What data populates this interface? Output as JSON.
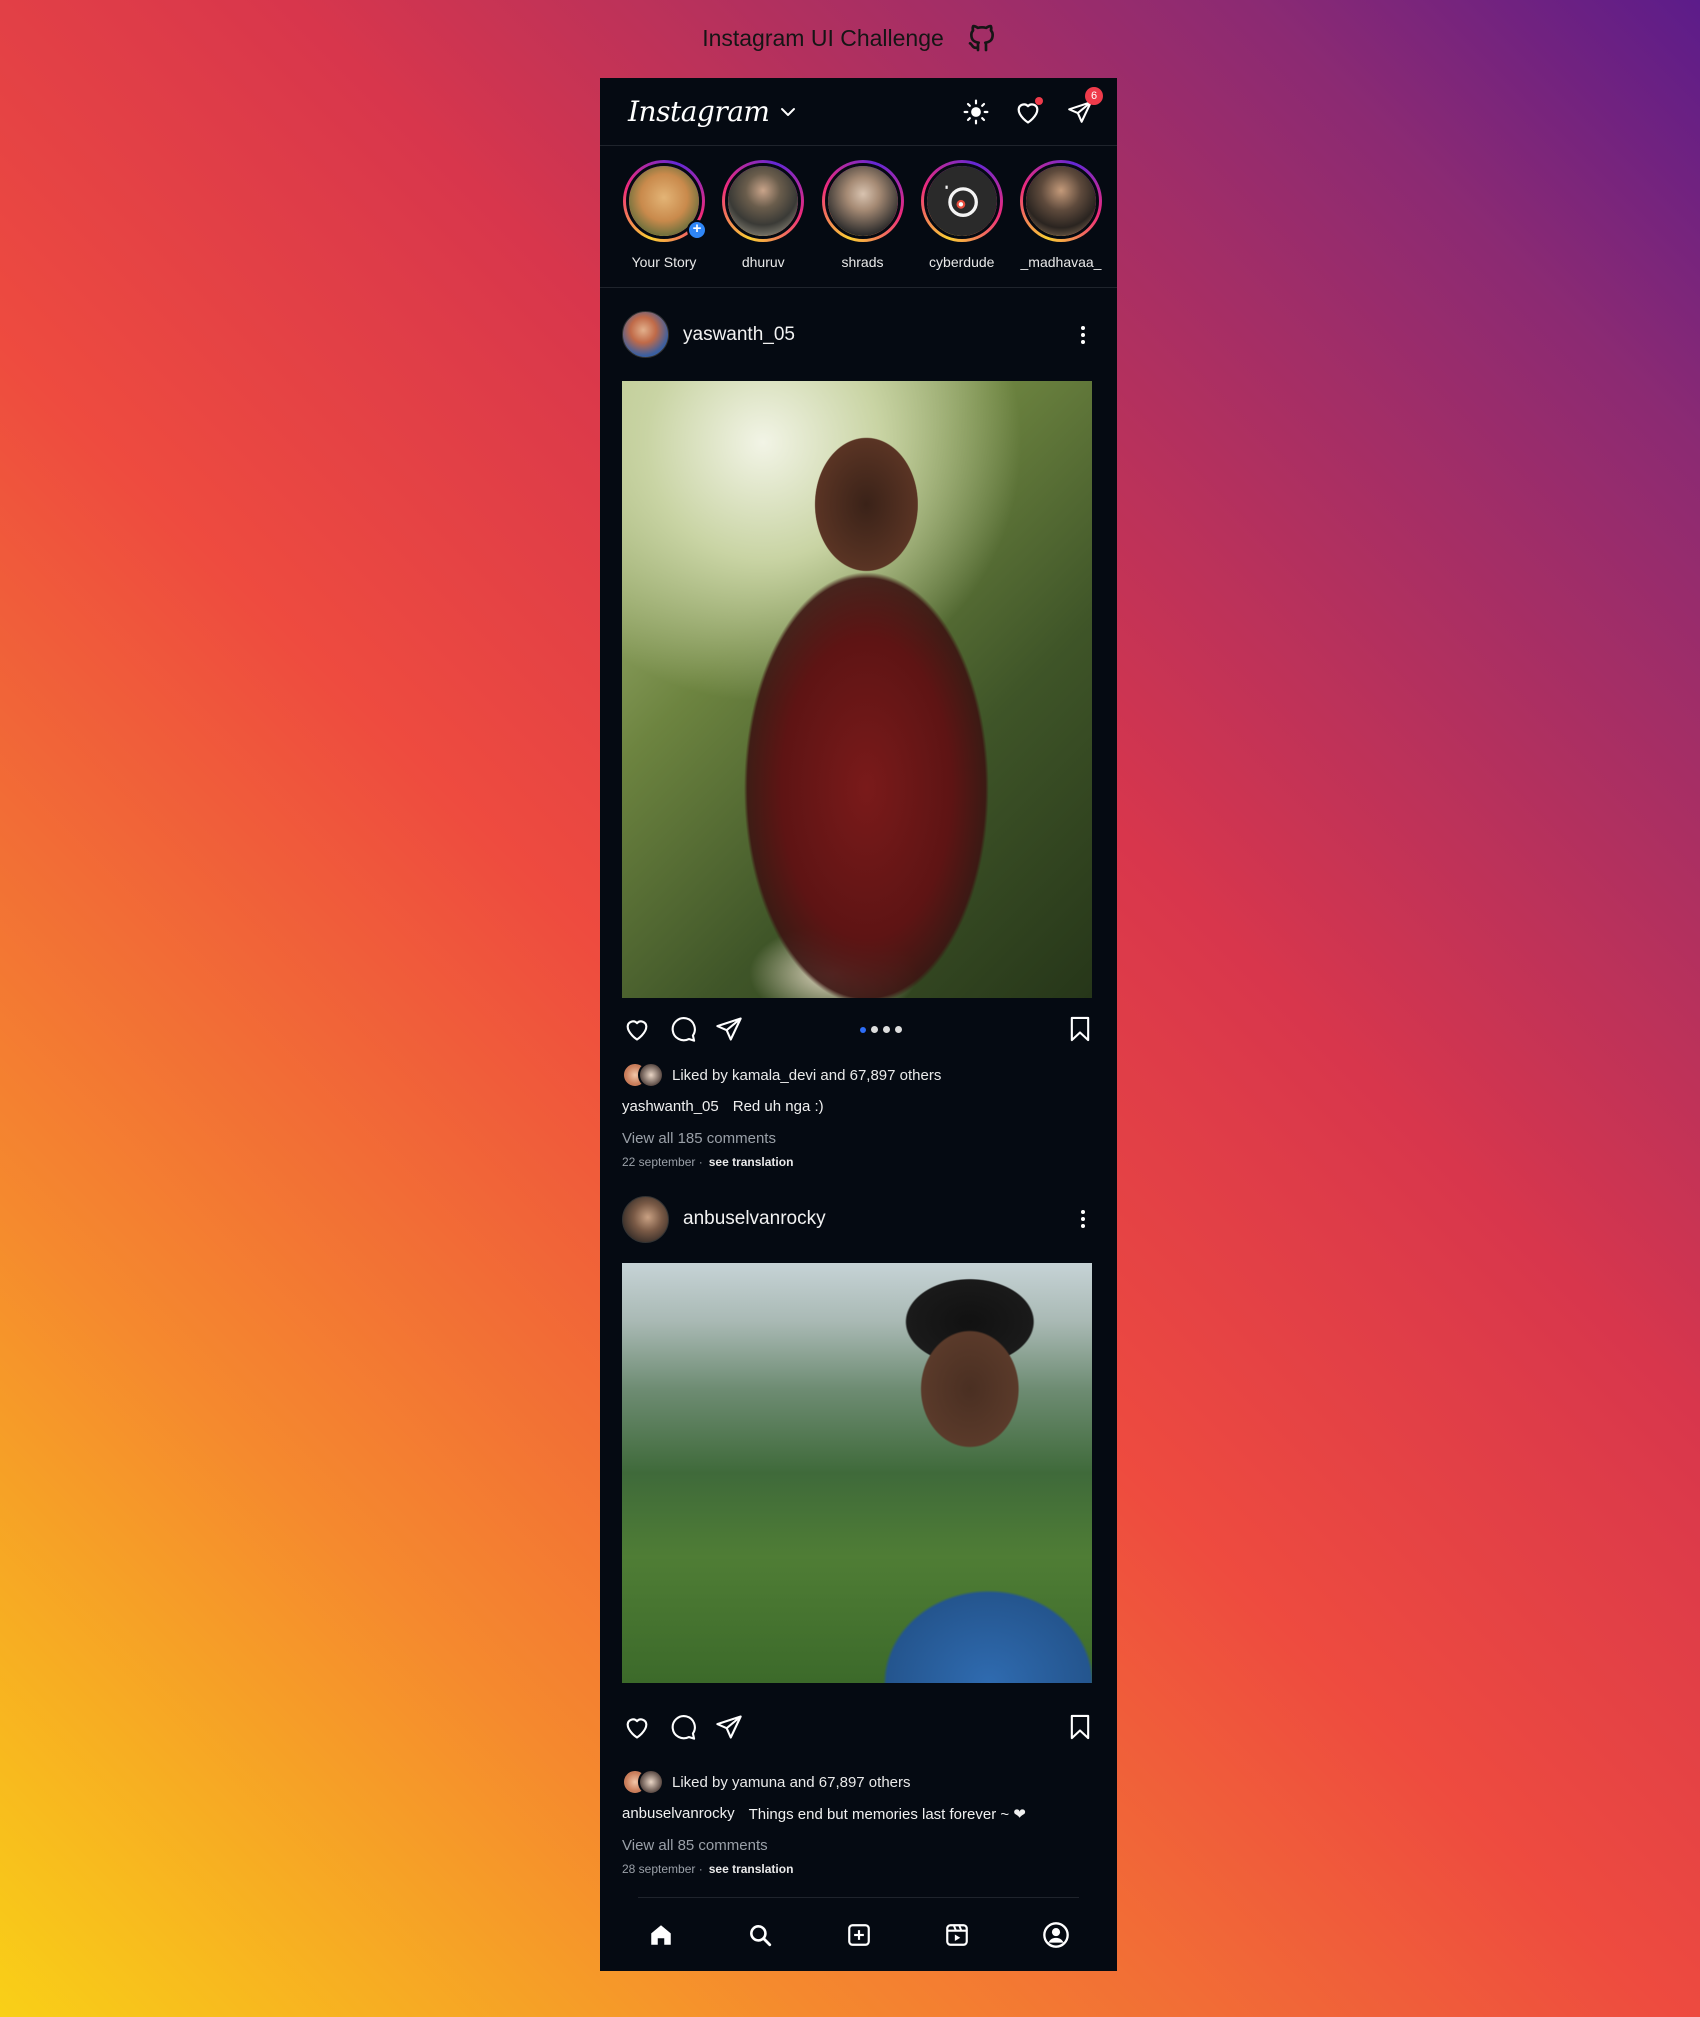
{
  "header": {
    "title": "Instagram UI Challenge",
    "icon": "github-icon"
  },
  "app": {
    "logo": "Instagram",
    "messages_badge": "6",
    "icons": [
      "chevron-down-icon",
      "theme-sun-icon",
      "heart-icon",
      "direct-send-icon"
    ]
  },
  "stories": [
    {
      "label": "Your Story",
      "colors": [
        "#c98a4c",
        "#e3b476"
      ]
    },
    {
      "label": "dhuruv",
      "colors": [
        "#5d5a4f",
        "#b3ad9a"
      ]
    },
    {
      "label": "shrads",
      "colors": [
        "#2b2b2b",
        "#a58a74"
      ]
    },
    {
      "label": "cyberdude",
      "colors": [
        "#2a2a2a",
        "#f4f4f4"
      ]
    },
    {
      "label": "_madhavaa_",
      "colors": [
        "#4a3a2e",
        "#a98a6a"
      ]
    }
  ],
  "posts": [
    {
      "username": "yaswanth_05",
      "liked_by": "Liked by kamala_devi and 67,897 others",
      "caption_user": "yashwanth_05",
      "caption_text": "Red uh nga :)",
      "comments": "View all 185 comments",
      "date": "22 september ·",
      "translate": "see translation"
    },
    {
      "username": "anbuselvanrocky",
      "liked_by": "Liked by yamuna and 67,897 others",
      "caption_user": "anbuselvanrocky",
      "caption_text": "Things end but memories last forever ~ ❤",
      "comments": "View all 85 comments",
      "date": "28 september ·",
      "translate": "see translation"
    }
  ],
  "nav": [
    "home-icon",
    "search-icon",
    "add-post-icon",
    "reels-icon",
    "profile-icon"
  ],
  "colors": {
    "background": "#050a12",
    "accent": "#2f86f6",
    "badge": "#ef3b4b"
  }
}
